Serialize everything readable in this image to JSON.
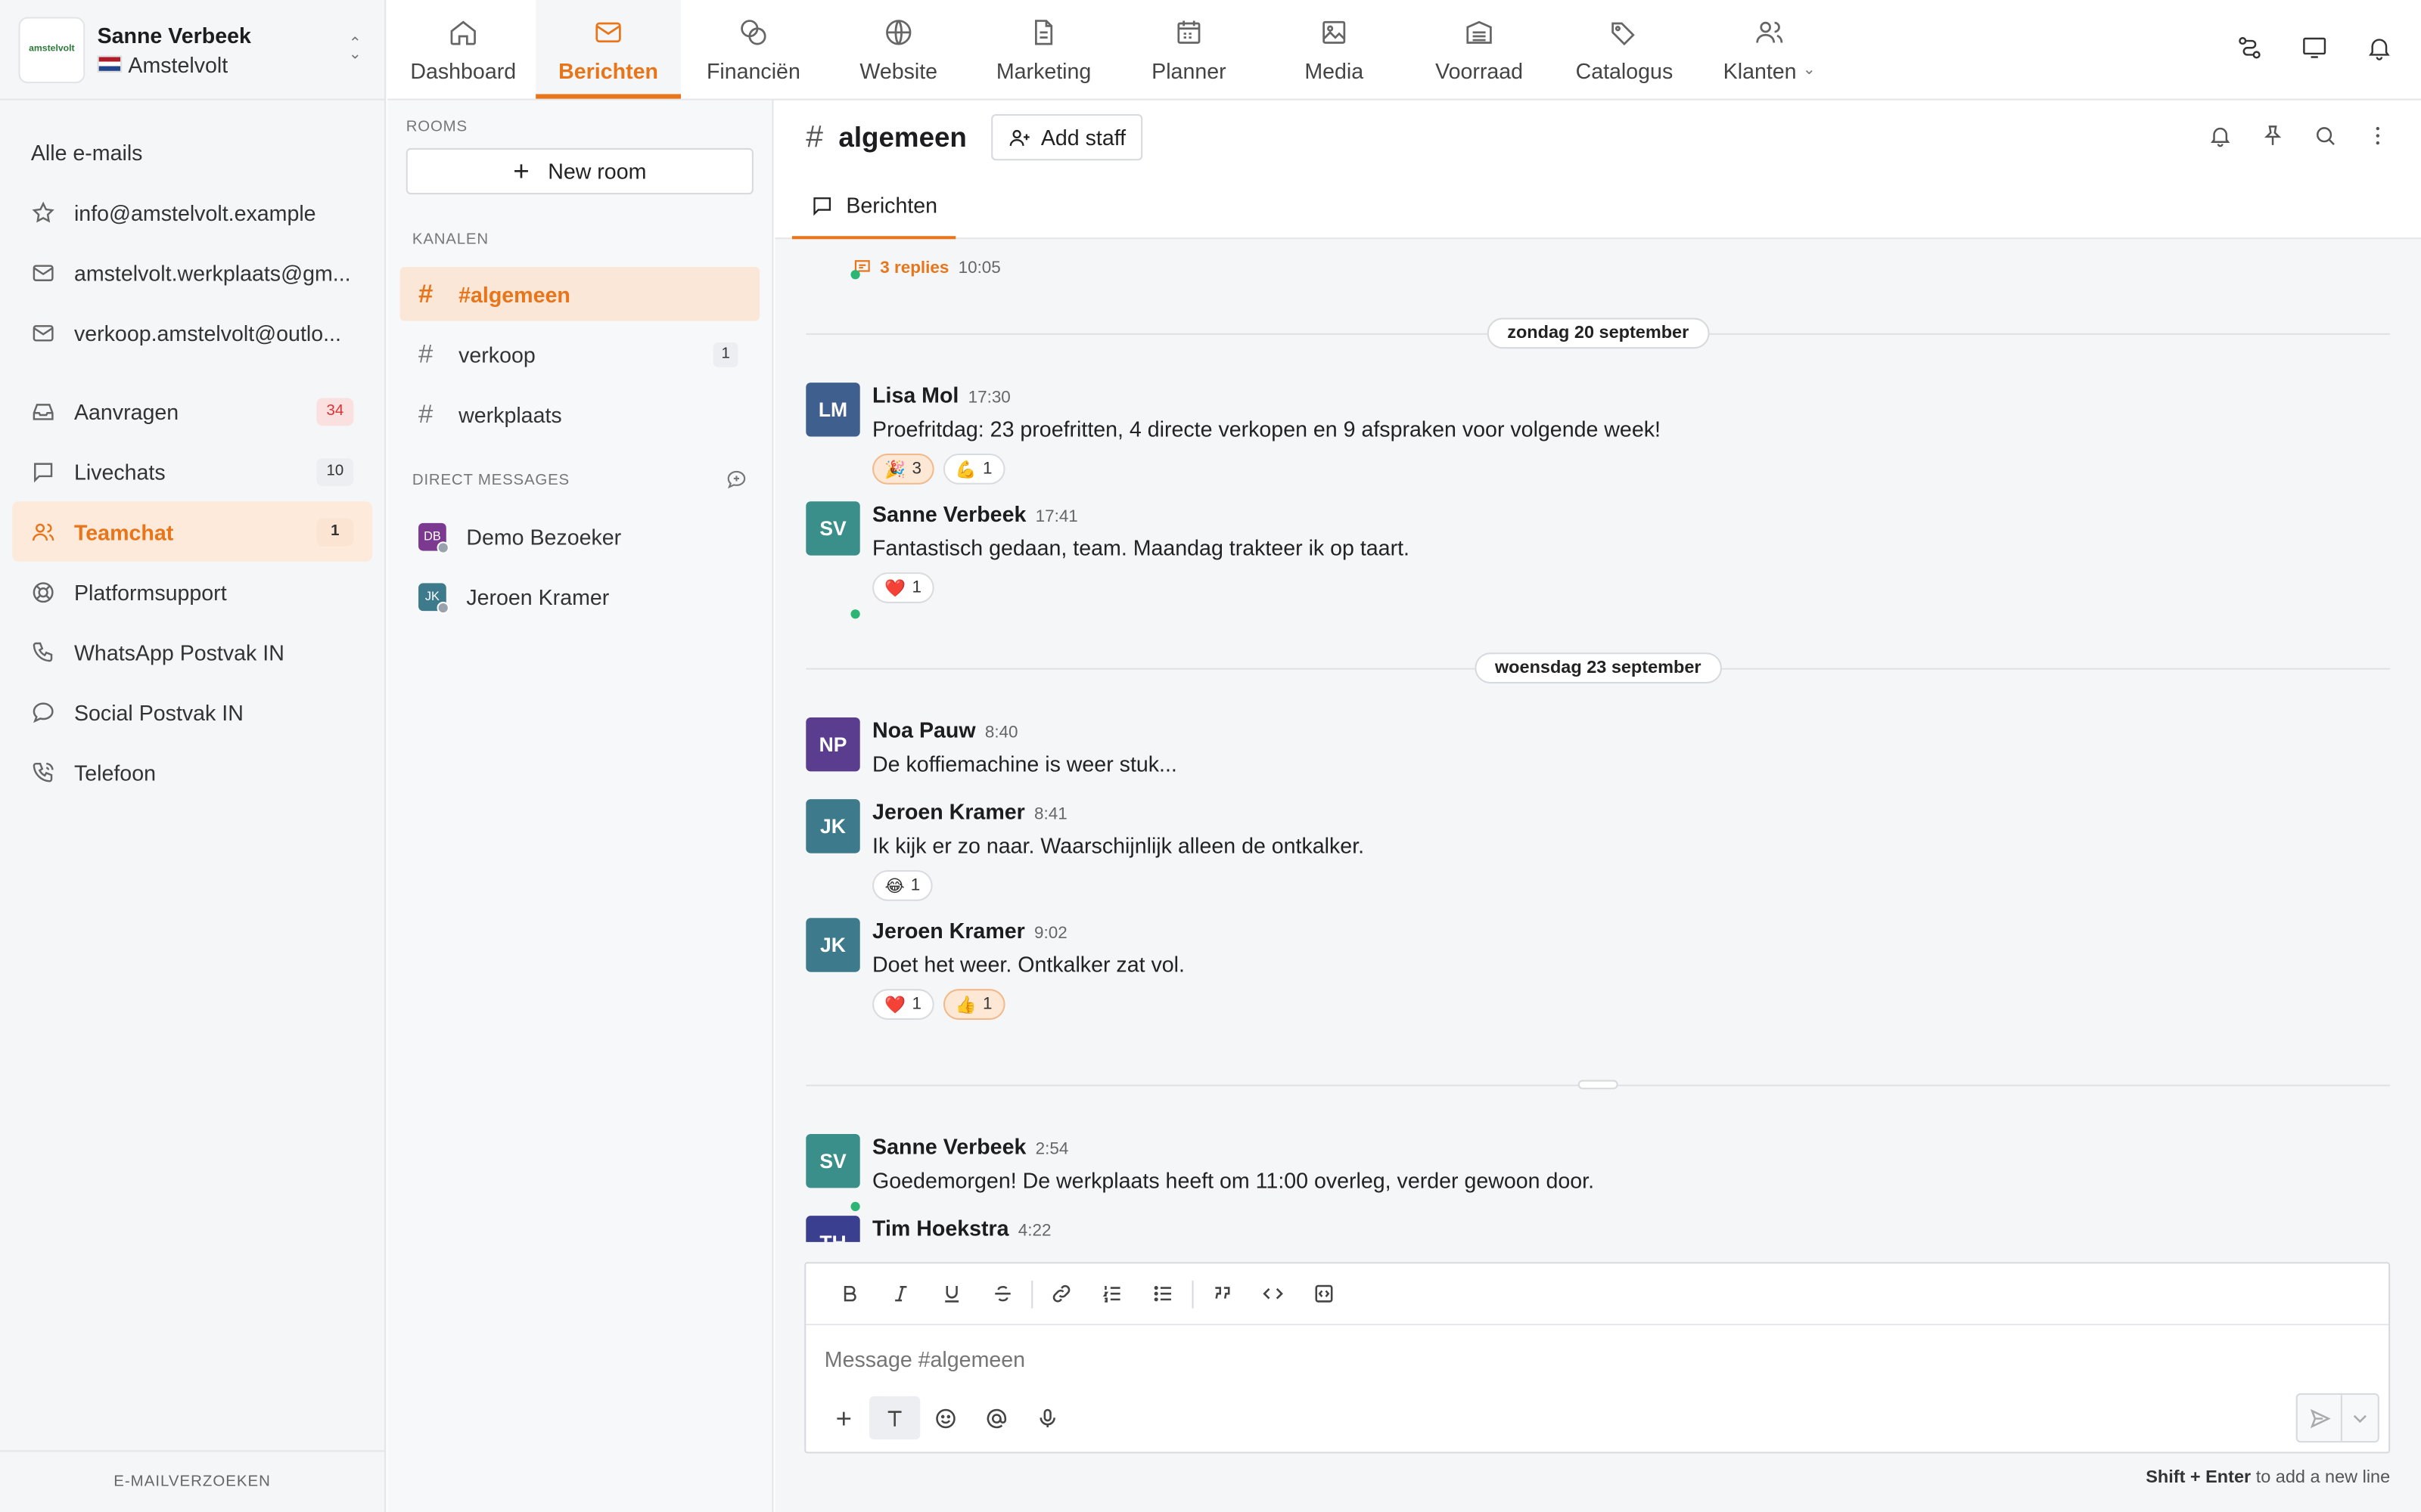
{
  "account": {
    "logo_text": "amstelvolt",
    "name": "Sanne Verbeek",
    "location": "Amstelvolt"
  },
  "sidebar": {
    "all_emails": "Alle e-mails",
    "mailboxes": [
      {
        "label": "info@amstelvolt.example",
        "icon": "star-icon"
      },
      {
        "label": "amstelvolt.werkplaats@gm...",
        "icon": "mail-icon"
      },
      {
        "label": "verkoop.amstelvolt@outlo...",
        "icon": "mail-icon"
      }
    ],
    "items": [
      {
        "label": "Aanvragen",
        "badge": "34",
        "icon": "inbox-icon"
      },
      {
        "label": "Livechats",
        "badge": "10",
        "icon": "chat-icon"
      },
      {
        "label": "Teamchat",
        "badge": "1",
        "icon": "users-icon"
      },
      {
        "label": "Platformsupport",
        "badge": "",
        "icon": "lifebuoy-icon"
      },
      {
        "label": "WhatsApp Postvak IN",
        "badge": "",
        "icon": "phone-icon"
      },
      {
        "label": "Social Postvak IN",
        "badge": "",
        "icon": "chat-icon"
      },
      {
        "label": "Telefoon",
        "badge": "",
        "icon": "phone-call-icon"
      }
    ],
    "footer": "E-MAILVERZOEKEN"
  },
  "topnav": {
    "tabs": [
      {
        "label": "Dashboard",
        "icon": "home-icon"
      },
      {
        "label": "Berichten",
        "icon": "mail-icon"
      },
      {
        "label": "Financiën",
        "icon": "coins-icon"
      },
      {
        "label": "Website",
        "icon": "globe-icon"
      },
      {
        "label": "Marketing",
        "icon": "document-icon"
      },
      {
        "label": "Planner",
        "icon": "calendar-icon"
      },
      {
        "label": "Media",
        "icon": "image-icon"
      },
      {
        "label": "Voorraad",
        "icon": "warehouse-icon"
      },
      {
        "label": "Catalogus",
        "icon": "tags-icon"
      },
      {
        "label": "Klanten",
        "icon": "users-icon"
      }
    ],
    "active_tab": "Berichten"
  },
  "rooms": {
    "title": "ROOMS",
    "new_room": "New room",
    "channels_title": "KANALEN",
    "channels": [
      {
        "label": "#algemeen",
        "badge": ""
      },
      {
        "label": "verkoop",
        "badge": "1"
      },
      {
        "label": "werkplaats",
        "badge": ""
      }
    ],
    "dm_title": "DIRECT MESSAGES",
    "dms": [
      {
        "initials": "DB",
        "name": "Demo Bezoeker",
        "color": "#7b3a8f"
      },
      {
        "initials": "JK",
        "name": "Jeroen Kramer",
        "color": "#3c7a8c"
      }
    ]
  },
  "chat": {
    "channel": "algemeen",
    "add_staff": "Add staff",
    "tab": "Berichten",
    "thread": {
      "replies": "3 replies",
      "time": "10:05"
    },
    "days": [
      "zondag 20 september",
      "woensdag 23 september"
    ],
    "messages": [
      {
        "initials": "LM",
        "color": "#3f5f8f",
        "author": "Lisa Mol",
        "time": "17:30",
        "text": "Proefritdag: 23 proefritten, 4 directe verkopen en 9 afspraken voor volgende week!",
        "reactions": [
          {
            "emoji": "🎉",
            "count": "3",
            "mine": true
          },
          {
            "emoji": "💪",
            "count": "1",
            "mine": false
          }
        ]
      },
      {
        "initials": "SV",
        "color": "#3a8f8a",
        "author": "Sanne Verbeek",
        "time": "17:41",
        "text": "Fantastisch gedaan, team. Maandag trakteer ik op taart.",
        "reactions": [
          {
            "emoji": "❤️",
            "count": "1",
            "mine": false
          }
        ]
      },
      {
        "initials": "NP",
        "color": "#5b3d8f",
        "author": "Noa Pauw",
        "time": "8:40",
        "text": "De koffiemachine is weer stuk...",
        "reactions": []
      },
      {
        "initials": "JK",
        "color": "#3c7a8c",
        "author": "Jeroen Kramer",
        "time": "8:41",
        "text": "Ik kijk er zo naar. Waarschijnlijk alleen de ontkalker.",
        "reactions": [
          {
            "emoji": "😂",
            "count": "1",
            "mine": false
          }
        ]
      },
      {
        "initials": "JK",
        "color": "#3c7a8c",
        "author": "Jeroen Kramer",
        "time": "9:02",
        "text": "Doet het weer. Ontkalker zat vol.",
        "reactions": [
          {
            "emoji": "❤️",
            "count": "1",
            "mine": false
          },
          {
            "emoji": "👍",
            "count": "1",
            "mine": true
          }
        ]
      },
      {
        "initials": "SV",
        "color": "#3a8f8a",
        "author": "Sanne Verbeek",
        "time": "2:54",
        "text": "Goedemorgen! De werkplaats heeft om 11:00 overleg, verder gewoon door.",
        "reactions": []
      },
      {
        "initials": "TH",
        "color": "#3b3f8f",
        "author": "Tim Hoekstra",
        "time": "4:22",
        "text": "",
        "reactions": []
      }
    ]
  },
  "composer": {
    "placeholder": "Message #algemeen",
    "hint_keys": "Shift + Enter",
    "hint_text": "to add a new line"
  },
  "colors": {
    "accent": "#e8751a",
    "accent_bg": "#fbe7d7",
    "online": "#2bb673"
  }
}
